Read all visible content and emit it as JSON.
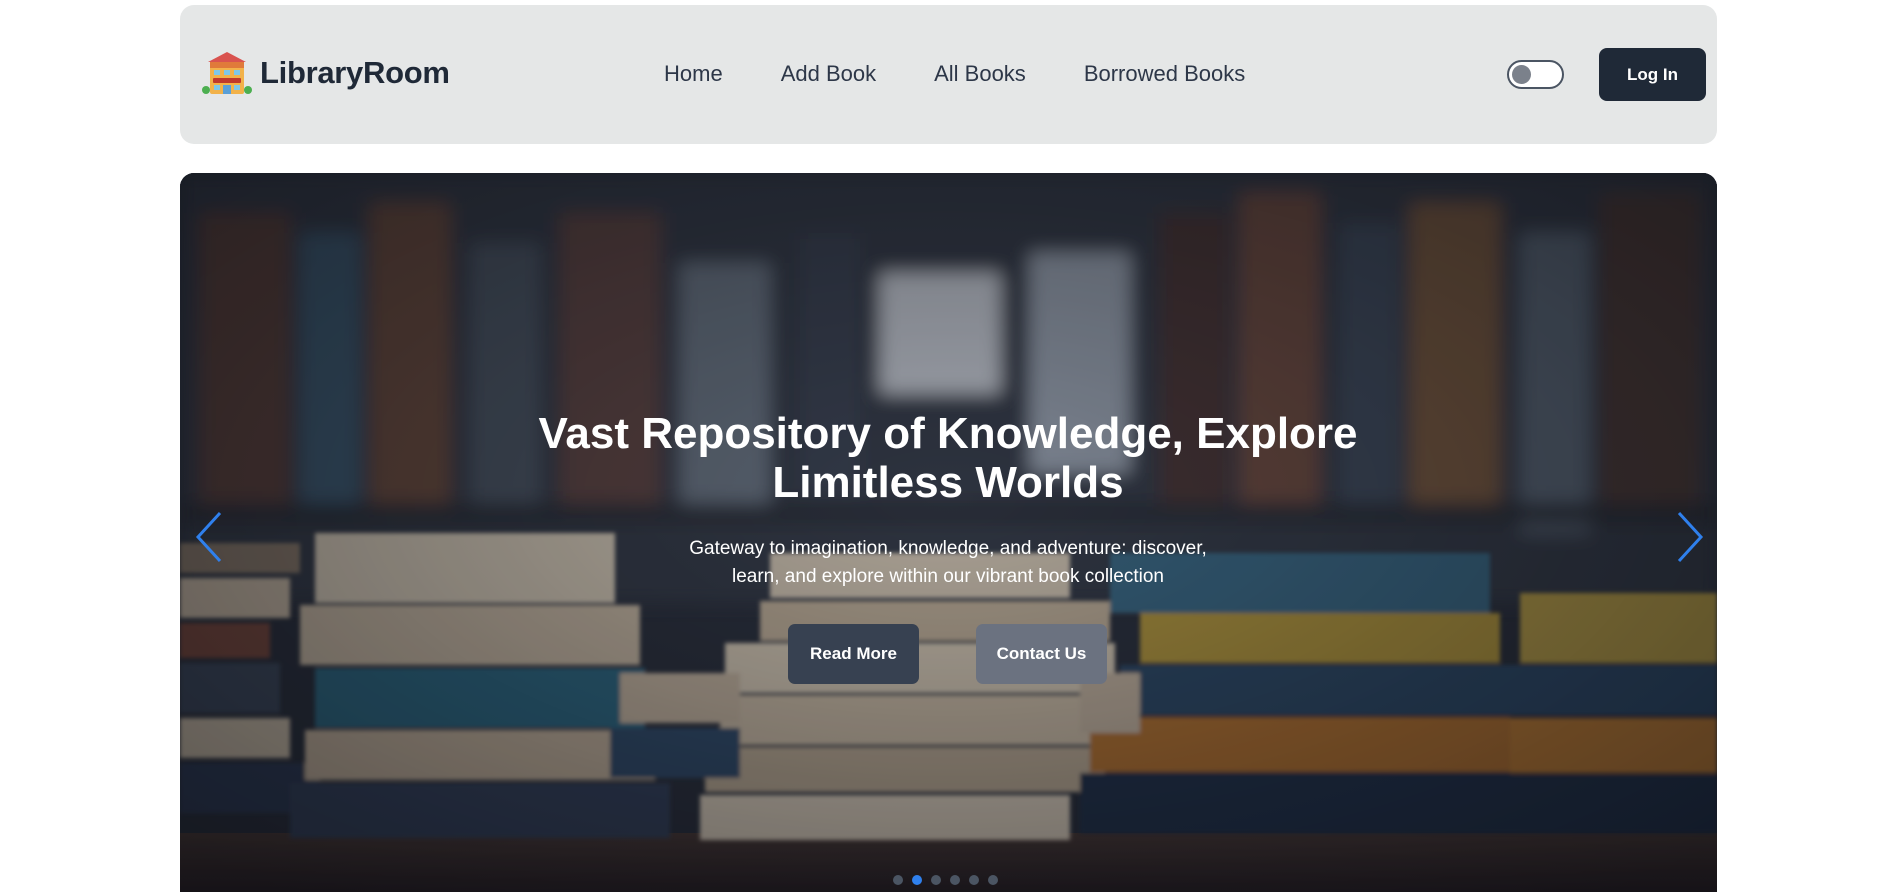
{
  "header": {
    "brand_name": "LibraryRoom",
    "brand_icon": "hotel-building-icon",
    "nav": [
      {
        "label": "Home"
      },
      {
        "label": "Add Book"
      },
      {
        "label": "All Books"
      },
      {
        "label": "Borrowed Books"
      }
    ],
    "theme_toggle": {
      "state": "off"
    },
    "login_label": "Log In"
  },
  "hero": {
    "background": "blurred bookshelves with stacks of books",
    "title": "Vast Repository of Knowledge, Explore Limitless Worlds",
    "subtitle": "Gateway to imagination, knowledge, and adventure: discover, learn, and explore within our vibrant book collection",
    "read_more_label": "Read More",
    "contact_label": "Contact Us",
    "prev_icon": "chevron-left-icon",
    "next_icon": "chevron-right-icon",
    "slides_total": 6,
    "active_slide": 2
  },
  "colors": {
    "navbar_bg": "#e5e7e7",
    "primary_dark": "#1f2937",
    "read_more_bg": "#374151",
    "contact_bg": "#6b7280",
    "accent_blue": "#2f80ed"
  }
}
